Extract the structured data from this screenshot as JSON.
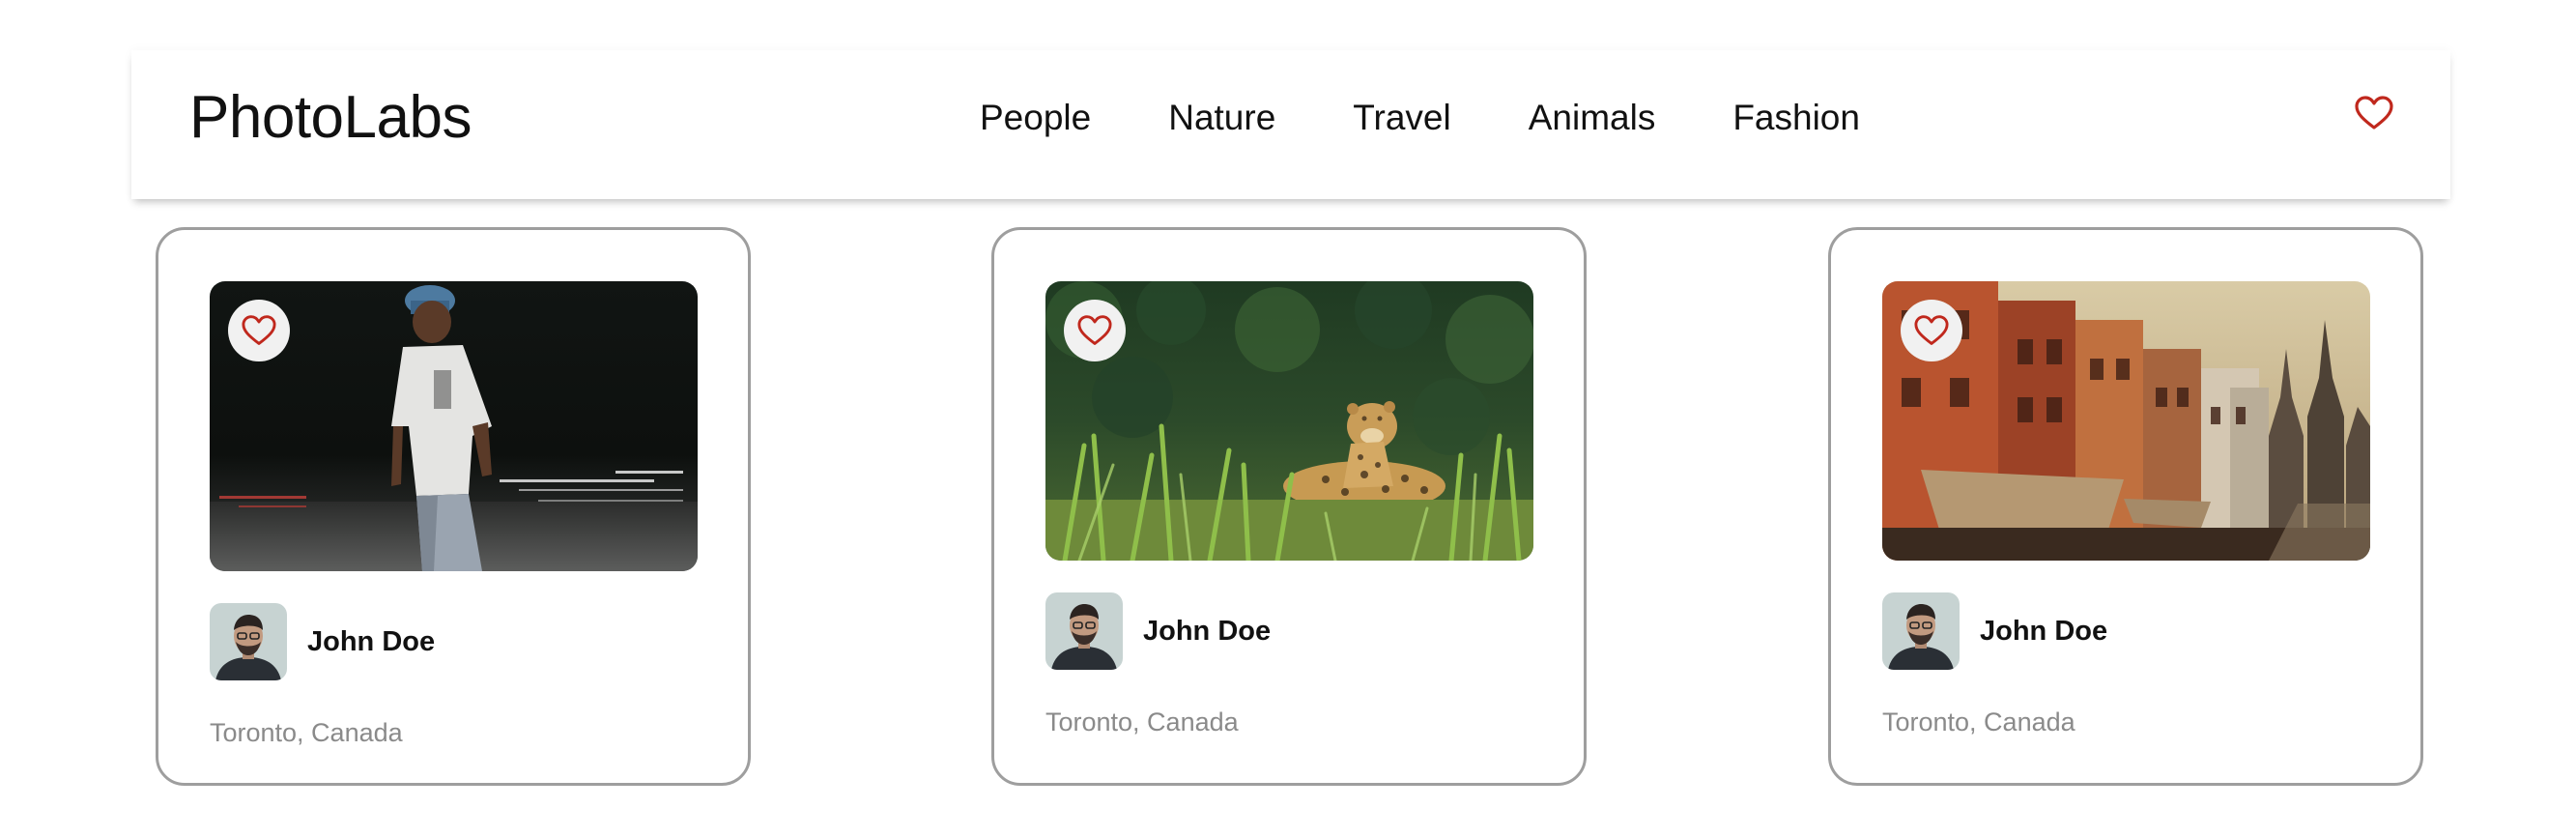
{
  "app": {
    "logo": "PhotoLabs"
  },
  "nav": {
    "topics": [
      "People",
      "Nature",
      "Travel",
      "Animals",
      "Fashion"
    ],
    "fav_icon": "heart-outline-icon",
    "accent_color": "#c0281d"
  },
  "photos": [
    {
      "subject": "man-in-cap-street-night",
      "fav_icon": "heart-outline-icon",
      "user": {
        "name": "John Doe",
        "avatar": "user-avatar"
      },
      "location": "Toronto, Canada"
    },
    {
      "subject": "leopard-in-grass",
      "fav_icon": "heart-outline-icon",
      "user": {
        "name": "John Doe",
        "avatar": "user-avatar"
      },
      "location": "Toronto, Canada"
    },
    {
      "subject": "old-city-buildings-temples",
      "fav_icon": "heart-outline-icon",
      "user": {
        "name": "John Doe",
        "avatar": "user-avatar"
      },
      "location": "Toronto, Canada"
    }
  ],
  "colors": {
    "card_border": "#9e9e9e",
    "location_text": "#8a8a8a",
    "heart": "#c0281d",
    "fav_badge_bg": "#f1f1f1"
  }
}
